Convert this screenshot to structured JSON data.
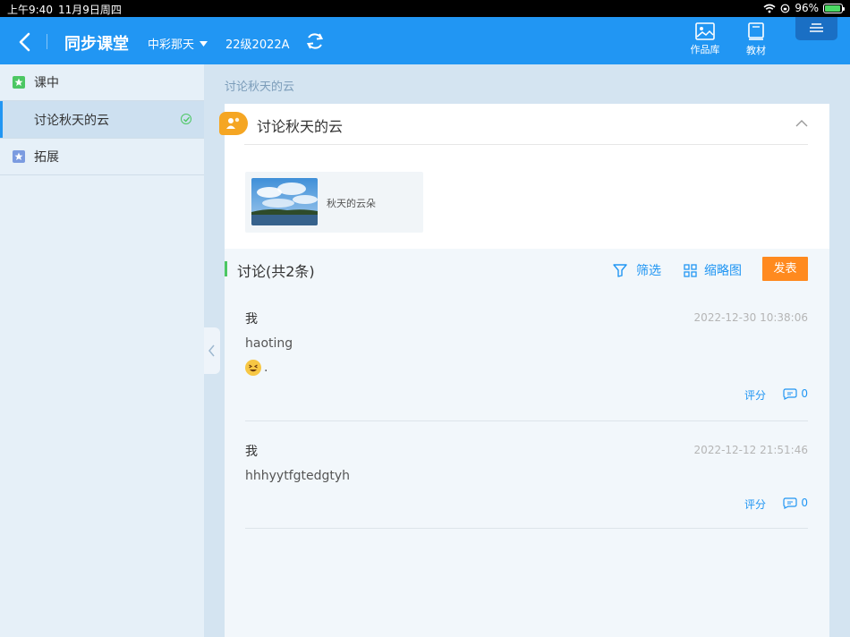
{
  "status": {
    "time": "上午9:40",
    "date": "11月9日周四",
    "battery": "96%",
    "battery_level": 0.96
  },
  "header": {
    "title": "同步课堂",
    "selector": "中彩那天",
    "class_name": "22级2022A",
    "tools": [
      {
        "label": "作品库",
        "icon": "image-icon"
      },
      {
        "label": "教材",
        "icon": "book-icon"
      }
    ]
  },
  "sidebar": {
    "items": [
      {
        "label": "课中",
        "icon": "star-icon",
        "color": "#4cc763"
      },
      {
        "label": "讨论秋天的云",
        "active": true,
        "completed": true
      },
      {
        "label": "拓展",
        "icon": "star-icon",
        "color": "#7b9be0"
      }
    ]
  },
  "breadcrumb": "讨论秋天的云",
  "card": {
    "title": "讨论秋天的云",
    "attachment": {
      "label": "秋天的云朵"
    }
  },
  "discussion": {
    "title": "讨论(共2条)",
    "filter_label": "筛选",
    "thumbnail_label": "缩略图",
    "post_button": "发表",
    "posts": [
      {
        "author": "我",
        "time": "2022-12-30 10:38:06",
        "text": "haoting",
        "extra": ".",
        "rate_label": "评分",
        "comments": "0"
      },
      {
        "author": "我",
        "time": "2022-12-12 21:51:46",
        "text": "hhhyytfgtedgtyh",
        "rate_label": "评分",
        "comments": "0"
      }
    ]
  },
  "colors": {
    "primary": "#2196f3",
    "accent": "#ff8a1f",
    "green": "#4cc763"
  }
}
